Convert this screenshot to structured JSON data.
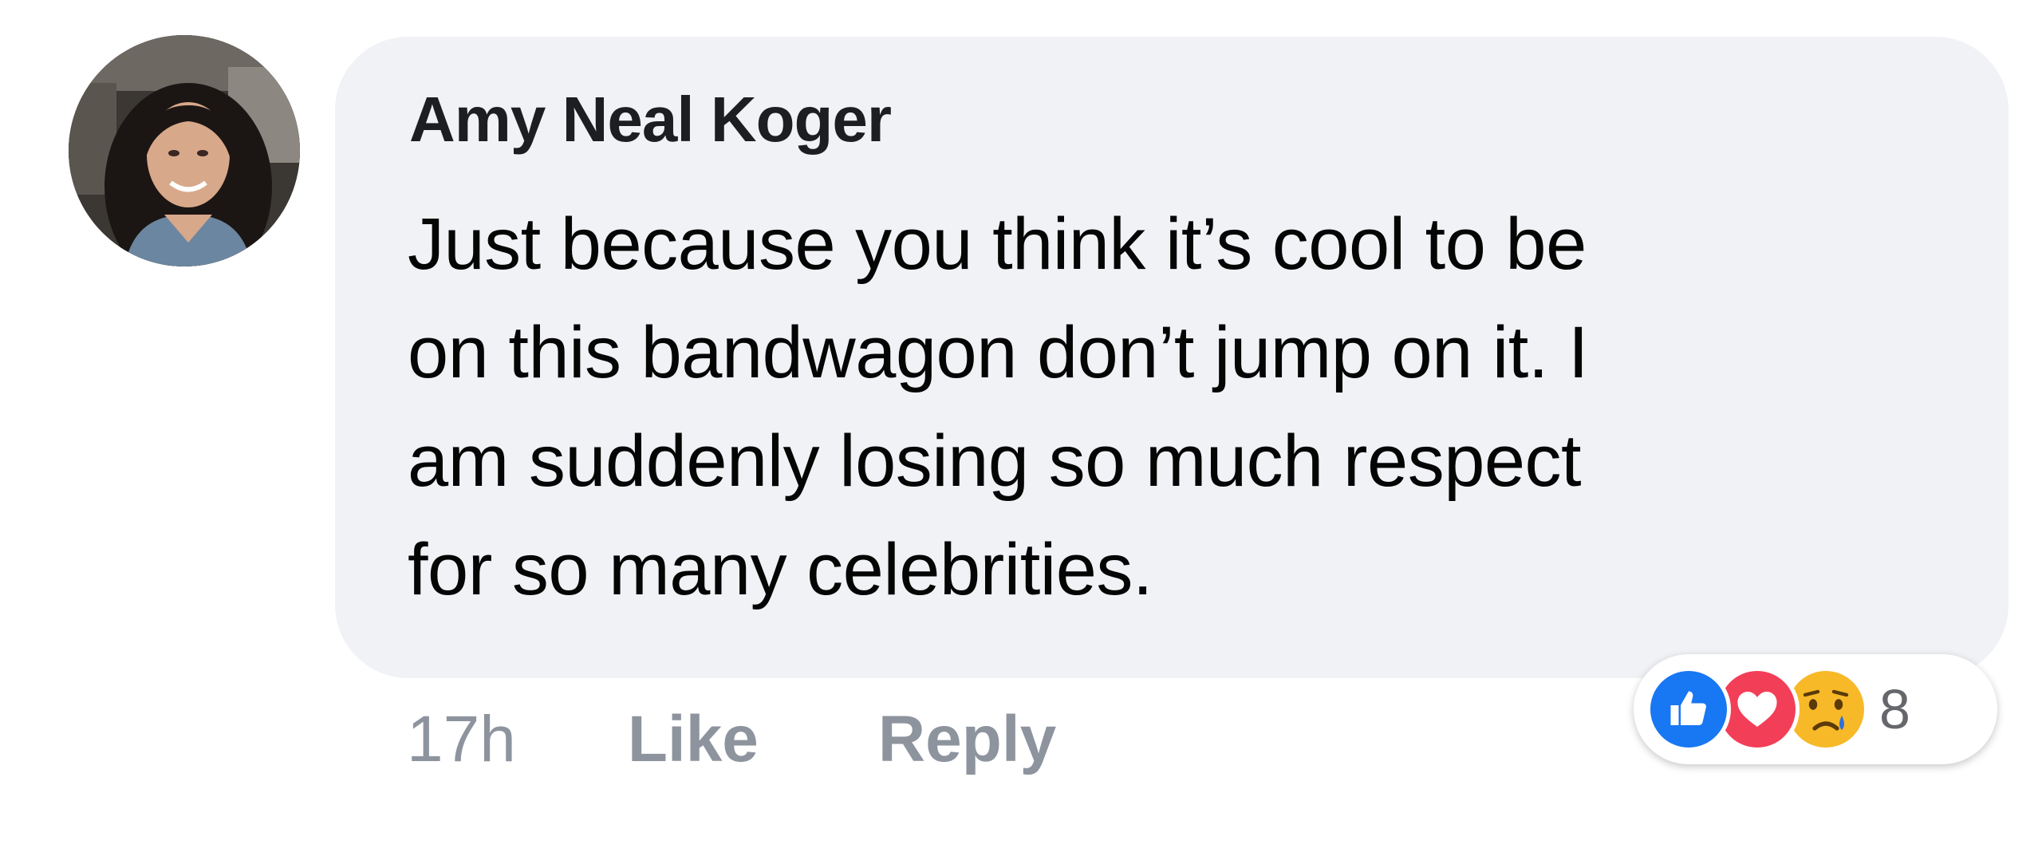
{
  "comment": {
    "author": "Amy Neal Koger",
    "text_lines": [
      "Just because you think it’s cool to be",
      "on this bandwagon don’t jump on it. I",
      "am suddenly losing so much respect",
      "for so many celebrities."
    ],
    "timestamp": "17h",
    "like_label": "Like",
    "reply_label": "Reply",
    "reactions": {
      "types": [
        "like-icon",
        "love-icon",
        "sad-icon"
      ],
      "count": "8"
    }
  },
  "colors": {
    "bubble": "#f0f2f5",
    "action_text": "#8d949e",
    "like": "#1877f2",
    "love": "#f33e58",
    "sad": "#f7b928"
  }
}
